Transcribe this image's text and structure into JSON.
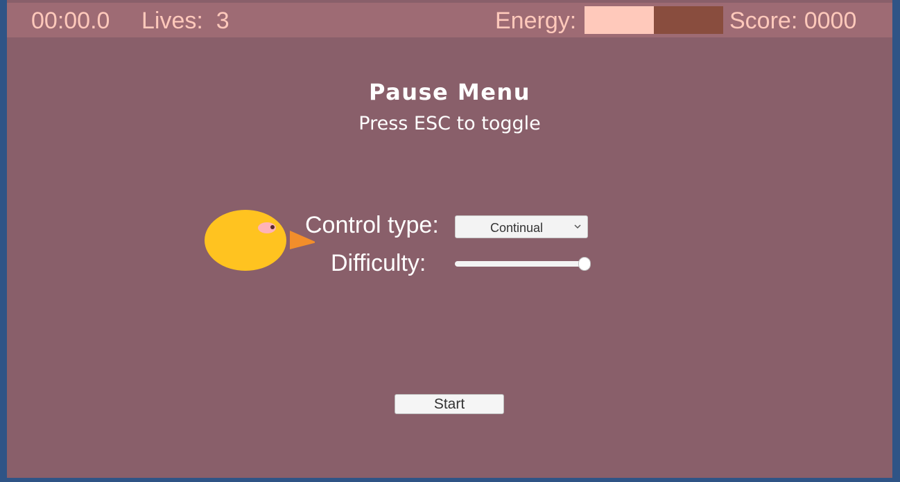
{
  "hud": {
    "timer": "00:00.0",
    "lives": "Lives:  3",
    "energy_label": "Energy:",
    "energy_level": 0.5,
    "score": "Score: 0000"
  },
  "pause_menu": {
    "title": "Pause Menu",
    "subtitle": "Press ESC to toggle",
    "control_type_label": "Control type:",
    "control_type_value": "Continual",
    "difficulty_label": "Difficulty:",
    "difficulty_level": 1.0,
    "start_label": "Start"
  },
  "icons": {
    "bird": "bird-icon",
    "dropdown": "chevron-down-icon"
  },
  "colors": {
    "background": "#895f6a",
    "hud_bar": "#9e6b74",
    "hud_text": "#ffc9bb",
    "energy_fill": "#ffc9bb",
    "energy_empty": "#894d3e",
    "bird_body": "#ffc320",
    "bird_beak": "#f28e2b",
    "bird_eye": "#ffb3b7",
    "window_border": "#2f5486"
  }
}
